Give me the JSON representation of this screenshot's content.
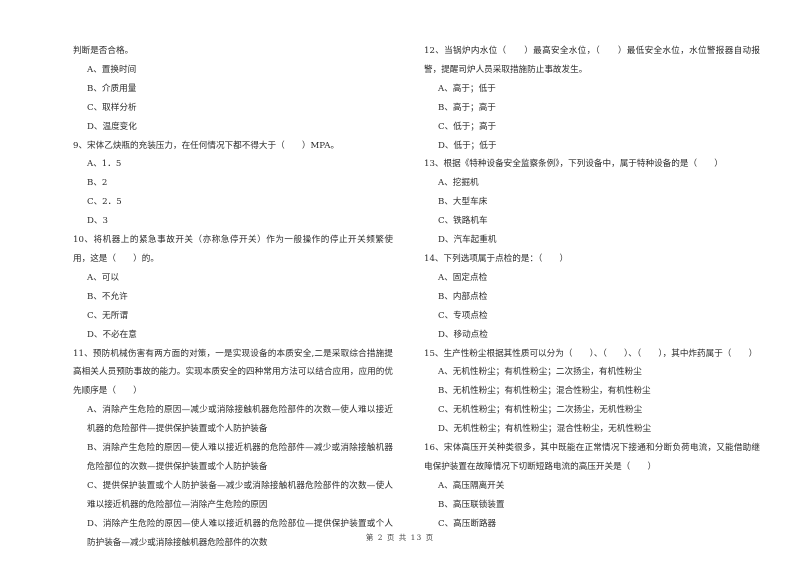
{
  "left_column": {
    "q8_tail": "判断是否合格。",
    "q8_options": [
      "A、置换时间",
      "B、介质用量",
      "C、取样分析",
      "D、温度变化"
    ],
    "q9": "9、宋体乙炔瓶的充装压力，在任何情况下都不得大于（　　）MPA。",
    "q9_options": [
      "A、1．5",
      "B、2",
      "C、2．5",
      "D、3"
    ],
    "q10": "10、将机器上的紧急事故开关（亦称急停开关）作为一般操作的停止开关频繁使用，这是（　　）的。",
    "q10_options": [
      "A、可以",
      "B、不允许",
      "C、无所谓",
      "D、不必在意"
    ],
    "q11": "11、预防机械伤害有两方面的对策，一是实现设备的本质安全,二是采取综合措施提高相关人员预防事故的能力。实现本质安全的四种常用方法可以结合应用，应用的优先顺序是（　　）",
    "q11_options": [
      "A、消除产生危险的原因—减少或消除接触机器危险部件的次数—使人难以接近机器的危险部件—提供保护装置或个人防护装备",
      "B、消除产生危险的原因—使人难以接近机器的危险部件—减少或消除接触机器危险部位的次数—提供保护装置或个人防护装备",
      "C、提供保护装置或个人防护装备—减少或消除接触机器危险部件的次数—使人难以接近机器的危险部位—消除产生危险的原因",
      "D、消除产生危险的原因—使人难以接近机器的危险部位—提供保护装置或个人防护装备—减少或消除接触机器危险部件的次数"
    ]
  },
  "right_column": {
    "q12": "12、当锅炉内水位（　　）最高安全水位，（　　）最低安全水位，水位警报器自动报警，提醒司炉人员采取措施防止事故发生。",
    "q12_options": [
      "A、高于；低于",
      "B、高于；高于",
      "C、低于；高于",
      "D、低于；低于"
    ],
    "q13": "13、根据《特种设备安全监察条例》，下列设备中，属于特种设备的是（　　）",
    "q13_options": [
      "A、挖掘机",
      "B、大型车床",
      "C、铁路机车",
      "D、汽车起重机"
    ],
    "q14": "14、下列选项属于点检的是：（　　）",
    "q14_options": [
      "A、固定点检",
      "B、内部点检",
      "C、专项点检",
      "D、移动点检"
    ],
    "q15": "15、生产性粉尘根据其性质可以分为（　　）、（　　）、（　　），其中炸药属于（　　）",
    "q15_options": [
      "A、无机性粉尘；有机性粉尘；二次扬尘，有机性粉尘",
      "B、无机性粉尘；有机性粉尘；混合性粉尘，有机性粉尘",
      "C、无机性粉尘；有机性粉尘；二次扬尘，无机性粉尘",
      "D、无机性粉尘；有机性粉尘；混合性粉尘，无机性粉尘"
    ],
    "q16": "16、宋体高压开关种类很多，其中既能在正常情况下接通和分断负荷电流，又能借助继电保护装置在故障情况下切断短路电流的高压开关是（　　）",
    "q16_options": [
      "A、高压隔离开关",
      "B、高压联锁装置",
      "C、高压断路器"
    ]
  },
  "footer": {
    "page_label": "第 2 页 共 13 页"
  }
}
